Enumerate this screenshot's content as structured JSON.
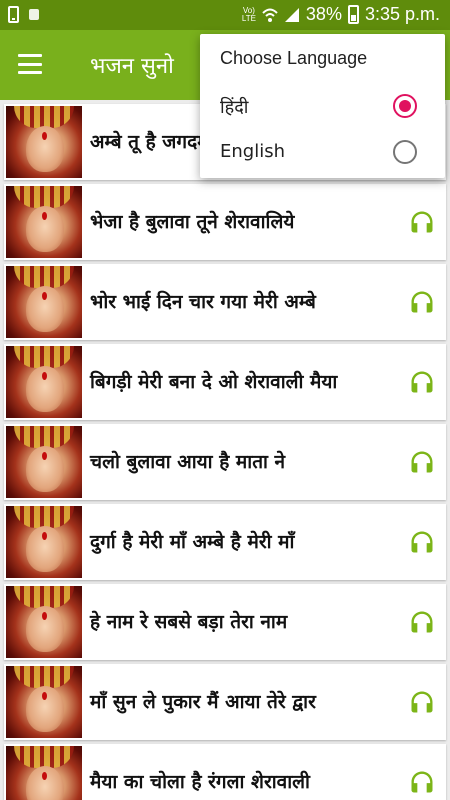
{
  "status_bar": {
    "battery": "38%",
    "time": "3:35 p.m.",
    "network_label": "VoLTE",
    "icons": [
      "phone-icon",
      "app-notification-icon",
      "volte-icon",
      "wifi-icon",
      "signal-icon",
      "battery-icon"
    ]
  },
  "app_bar": {
    "title": "भजन सुनो",
    "menu_icon": "hamburger-menu-icon",
    "color": "#79b01c"
  },
  "songs": [
    {
      "title": "अम्बे तू है जगदम्बे काली"
    },
    {
      "title": "भेजा है बुलावा तूने शेरावालिये"
    },
    {
      "title": "भोर भाई दिन चार गया मेरी अम्बे"
    },
    {
      "title": "बिगड़ी मेरी बना दे ओ शेरावाली मैया"
    },
    {
      "title": "चलो बुलावा आया है माता ने"
    },
    {
      "title": "दुर्गा है मेरी माँ अम्बे है मेरी माँ"
    },
    {
      "title": "हे नाम रे सबसे बड़ा तेरा नाम"
    },
    {
      "title": "माँ सुन ले पुकार मैं आया तेरे द्वार"
    },
    {
      "title": "मैया का चोला है रंगला शेरावाली"
    }
  ],
  "language_menu": {
    "title": "Choose Language",
    "options": [
      {
        "label": "हिंदी",
        "selected": true
      },
      {
        "label": "English",
        "selected": false
      }
    ],
    "accent_color": "#e0115f"
  },
  "colors": {
    "headphone_icon": "#7cb518",
    "status_bar": "#5f8c0c"
  }
}
